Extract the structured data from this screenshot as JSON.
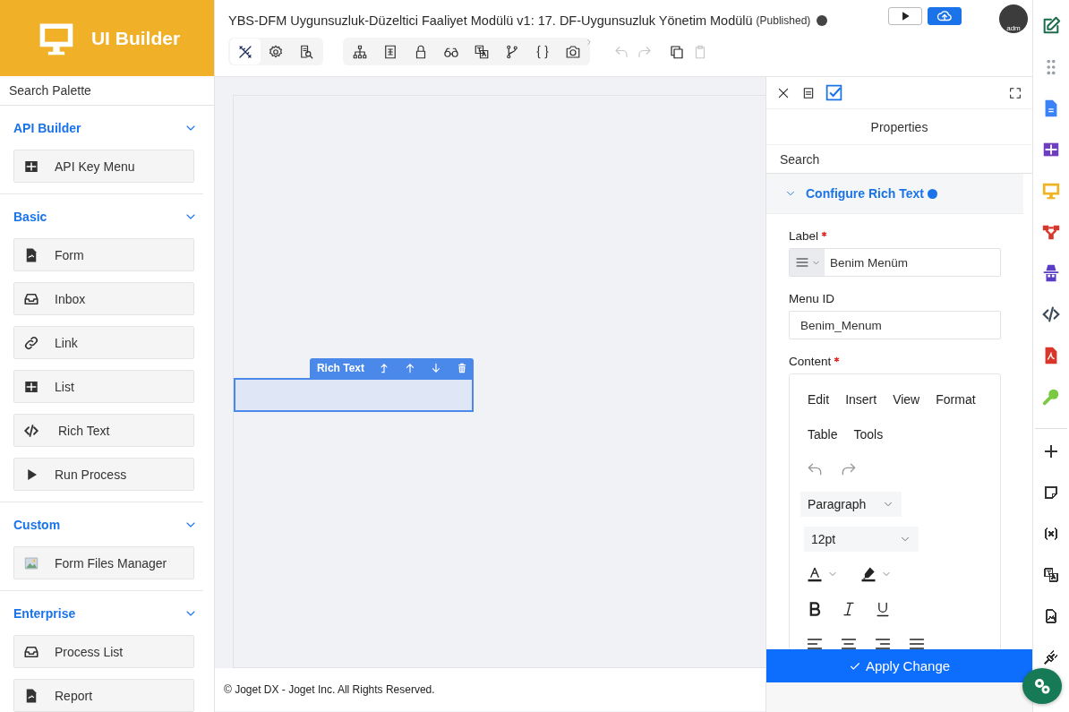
{
  "app": {
    "title": "UI Builder"
  },
  "header": {
    "title": "YBS-DFM Uygunsuzluk-Düzeltici Faaliyet Modülü v1: 17. DF-Uygunsuzluk Yönetim Modülü",
    "status": "(Published)"
  },
  "toolbar": {
    "groups": [
      [
        {
          "kind": "design",
          "selected": true
        },
        {
          "kind": "settings",
          "selected": false
        },
        {
          "kind": "preview",
          "selected": false
        }
      ],
      [
        {
          "kind": "tree",
          "selected": false
        },
        {
          "kind": "form",
          "selected": false
        },
        {
          "kind": "lock",
          "selected": false
        },
        {
          "kind": "binoculars",
          "selected": false
        },
        {
          "kind": "translate",
          "selected": false
        },
        {
          "kind": "branch",
          "selected": false
        },
        {
          "kind": "braces",
          "selected": false
        },
        {
          "kind": "camera",
          "selected": false
        }
      ]
    ],
    "actions": [
      {
        "kind": "undo",
        "disabled": true
      },
      {
        "kind": "redo",
        "disabled": true
      },
      {
        "kind": "copy",
        "disabled": false
      },
      {
        "kind": "paste",
        "disabled": true
      }
    ]
  },
  "publish": [
    {
      "kind": "play"
    },
    {
      "kind": "cloud"
    }
  ],
  "user": {
    "label": "adm"
  },
  "palette": {
    "search_placeholder": "Search Palette",
    "categories": [
      {
        "name": "API Builder",
        "expanded": true,
        "items": [
          {
            "label": "API Key Menu",
            "kind": "grid"
          }
        ]
      },
      {
        "name": "Basic",
        "expanded": true,
        "items": [
          {
            "label": "Form",
            "kind": "file"
          },
          {
            "label": "Inbox",
            "kind": "inbox"
          },
          {
            "label": "Link",
            "kind": "link"
          },
          {
            "label": "List",
            "kind": "grid"
          },
          {
            "label": "Rich Text",
            "kind": "html"
          },
          {
            "label": "Run Process",
            "kind": "play"
          }
        ]
      },
      {
        "name": "Custom",
        "expanded": true,
        "items": [
          {
            "label": "Form Files Manager",
            "kind": "image"
          }
        ]
      },
      {
        "name": "Enterprise",
        "expanded": true,
        "items": [
          {
            "label": "Process List",
            "kind": "inbox"
          },
          {
            "label": "Report",
            "kind": "file"
          }
        ]
      }
    ]
  },
  "canvas": {
    "element": {
      "label": "Rich Text",
      "selected": true,
      "actions": [
        {
          "kind": "up-level"
        },
        {
          "kind": "up"
        },
        {
          "kind": "down"
        },
        {
          "kind": "delete"
        }
      ]
    }
  },
  "footer": "© Joget DX - Joget Inc. All Rights Reserved.",
  "properties": {
    "tabs": [
      {
        "kind": "close",
        "selected": false
      },
      {
        "kind": "list",
        "selected": false
      },
      {
        "kind": "check",
        "selected": true
      }
    ],
    "title": "Properties",
    "search_placeholder": "Search",
    "section": {
      "title": "Configure Rich Text",
      "expanded": true
    },
    "fields": [
      {
        "kind": "text-menu",
        "label": "Label",
        "required": true,
        "value": "Benim Menüm"
      },
      {
        "kind": "text",
        "label": "Menu ID",
        "required": false,
        "value": "Benim_Menum"
      },
      {
        "kind": "editor",
        "label": "Content",
        "required": true
      }
    ],
    "editor": {
      "menus": [
        "Edit",
        "Insert",
        "View",
        "Format",
        "Table",
        "Tools"
      ],
      "block_format": "Paragraph",
      "font_size": "12pt"
    },
    "apply_button": "Apply Change"
  },
  "rail": [
    {
      "kind": "edit",
      "color": "#1d6b4a"
    },
    {
      "kind": "dots",
      "color": "#9aa0a6"
    },
    {
      "kind": "doc",
      "color": "#3b82f6"
    },
    {
      "kind": "grid",
      "color": "#6d3fc0"
    },
    {
      "kind": "monitor",
      "color": "#f0b323"
    },
    {
      "kind": "flow",
      "color": "#d9362b"
    },
    {
      "kind": "spy",
      "color": "#5b3cc4"
    },
    {
      "kind": "code",
      "color": "#3c4a5a"
    },
    {
      "kind": "pdf",
      "color": "#d9362b"
    },
    {
      "kind": "key",
      "color": "#7ac943"
    },
    {
      "kind": "plus",
      "color": "#333333"
    },
    {
      "kind": "note",
      "color": "#333333"
    },
    {
      "kind": "var",
      "color": "#333333"
    },
    {
      "kind": "translate",
      "color": "#333333"
    },
    {
      "kind": "picfile",
      "color": "#333333"
    },
    {
      "kind": "plug",
      "color": "#333333"
    }
  ]
}
